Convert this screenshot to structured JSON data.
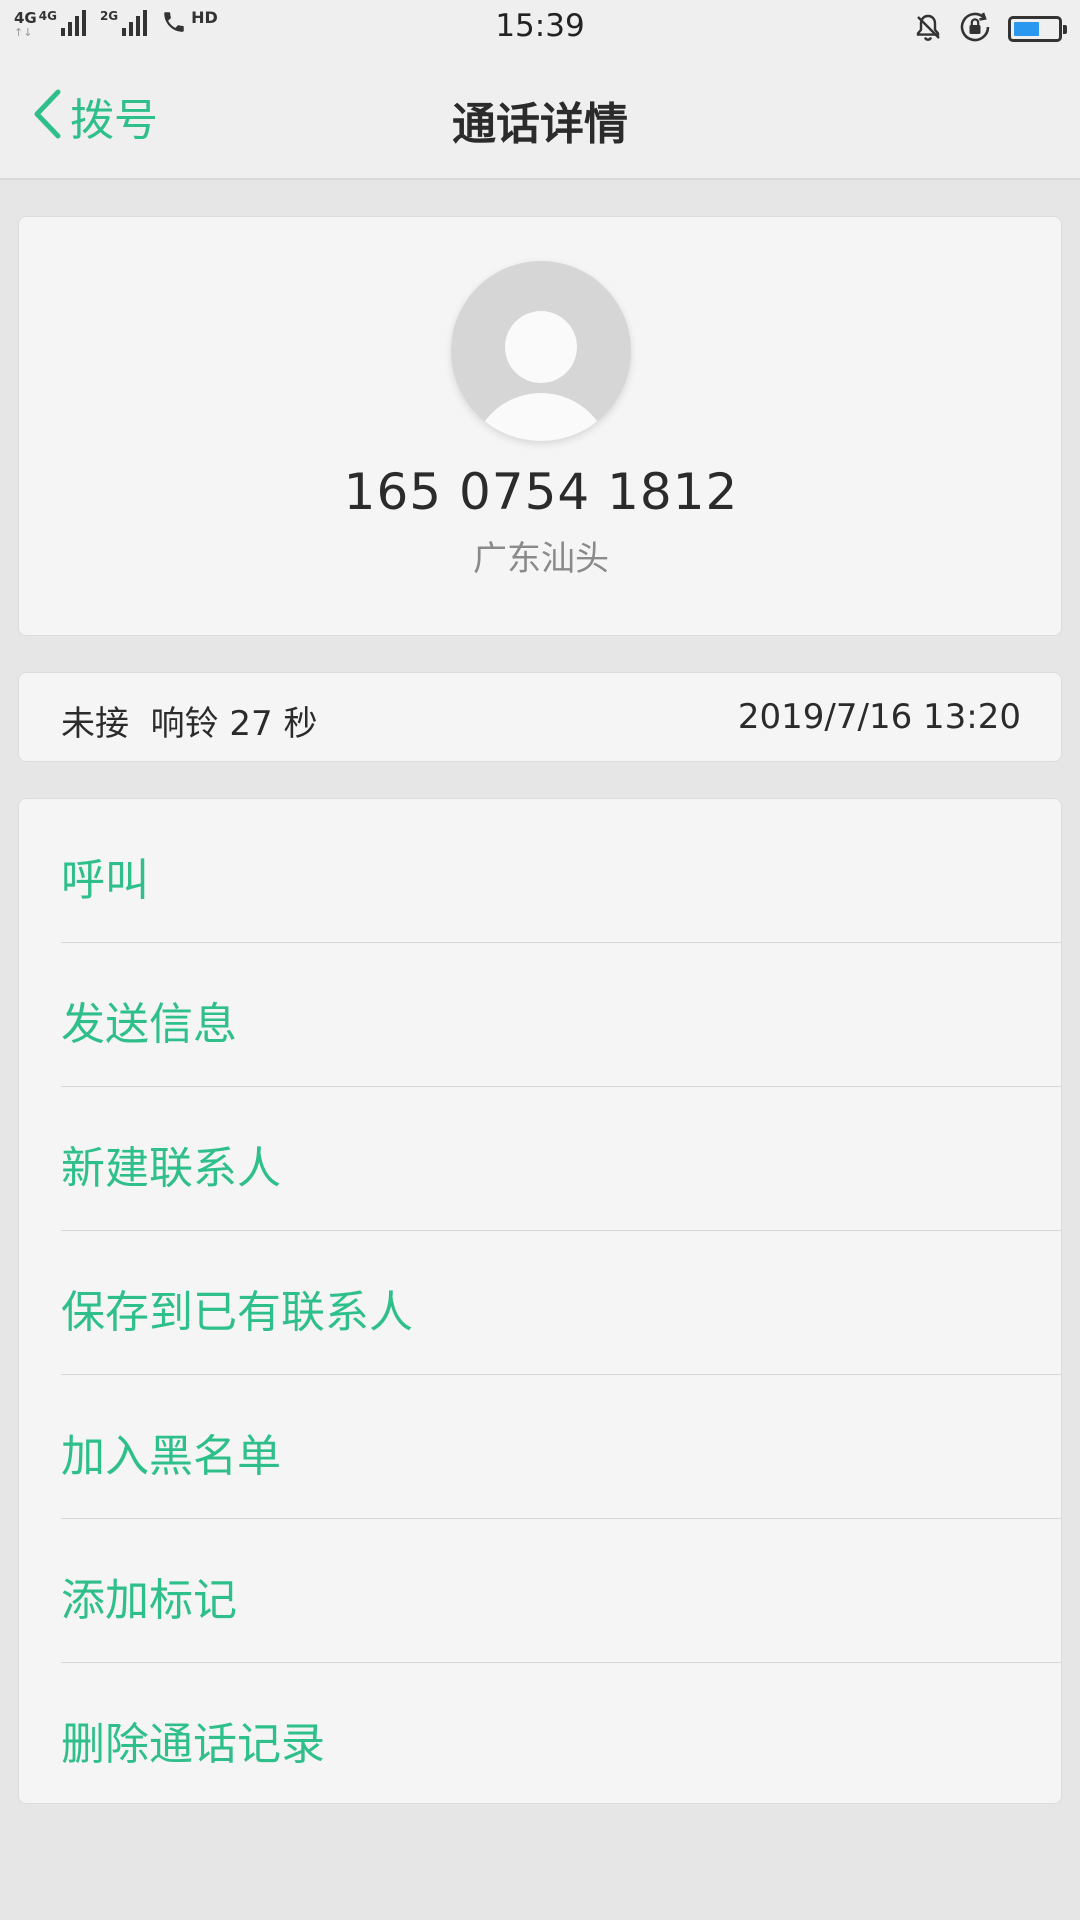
{
  "status_bar": {
    "net1": "4G",
    "net2": "4G",
    "net3": "2G",
    "arrows": "↑↓",
    "hd": "HD",
    "time": "15:39",
    "battery_level": 0.6
  },
  "header": {
    "back_label": "拨号",
    "title": "通话详情"
  },
  "contact": {
    "number": "165 0754 1812",
    "location": "广东汕头"
  },
  "call": {
    "status": "未接  响铃 27 秒",
    "datetime": "2019/7/16 13:20"
  },
  "actions": [
    {
      "label": "呼叫"
    },
    {
      "label": "发送信息"
    },
    {
      "label": "新建联系人"
    },
    {
      "label": "保存到已有联系人"
    },
    {
      "label": "加入黑名单"
    },
    {
      "label": "添加标记"
    },
    {
      "label": "删除通话记录"
    }
  ],
  "colors": {
    "accent": "#2fbf8a",
    "background": "#e6e6e6",
    "card": "#f5f5f5",
    "battery": "#2b98f0"
  }
}
